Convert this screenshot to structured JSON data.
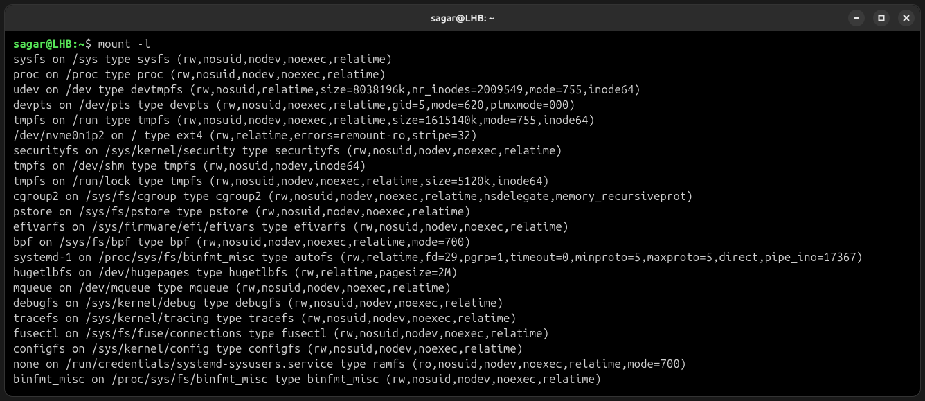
{
  "titlebar": {
    "title": "sagar@LHB: ~"
  },
  "prompt": {
    "user_host": "sagar@LHB",
    "colon": ":",
    "path": "~",
    "dollar": "$ ",
    "command": "mount -l"
  },
  "output_lines": [
    "sysfs on /sys type sysfs (rw,nosuid,nodev,noexec,relatime)",
    "proc on /proc type proc (rw,nosuid,nodev,noexec,relatime)",
    "udev on /dev type devtmpfs (rw,nosuid,relatime,size=8038196k,nr_inodes=2009549,mode=755,inode64)",
    "devpts on /dev/pts type devpts (rw,nosuid,noexec,relatime,gid=5,mode=620,ptmxmode=000)",
    "tmpfs on /run type tmpfs (rw,nosuid,nodev,noexec,relatime,size=1615140k,mode=755,inode64)",
    "/dev/nvme0n1p2 on / type ext4 (rw,relatime,errors=remount-ro,stripe=32)",
    "securityfs on /sys/kernel/security type securityfs (rw,nosuid,nodev,noexec,relatime)",
    "tmpfs on /dev/shm type tmpfs (rw,nosuid,nodev,inode64)",
    "tmpfs on /run/lock type tmpfs (rw,nosuid,nodev,noexec,relatime,size=5120k,inode64)",
    "cgroup2 on /sys/fs/cgroup type cgroup2 (rw,nosuid,nodev,noexec,relatime,nsdelegate,memory_recursiveprot)",
    "pstore on /sys/fs/pstore type pstore (rw,nosuid,nodev,noexec,relatime)",
    "efivarfs on /sys/firmware/efi/efivars type efivarfs (rw,nosuid,nodev,noexec,relatime)",
    "bpf on /sys/fs/bpf type bpf (rw,nosuid,nodev,noexec,relatime,mode=700)",
    "systemd-1 on /proc/sys/fs/binfmt_misc type autofs (rw,relatime,fd=29,pgrp=1,timeout=0,minproto=5,maxproto=5,direct,pipe_ino=17367)",
    "hugetlbfs on /dev/hugepages type hugetlbfs (rw,relatime,pagesize=2M)",
    "mqueue on /dev/mqueue type mqueue (rw,nosuid,nodev,noexec,relatime)",
    "debugfs on /sys/kernel/debug type debugfs (rw,nosuid,nodev,noexec,relatime)",
    "tracefs on /sys/kernel/tracing type tracefs (rw,nosuid,nodev,noexec,relatime)",
    "fusectl on /sys/fs/fuse/connections type fusectl (rw,nosuid,nodev,noexec,relatime)",
    "configfs on /sys/kernel/config type configfs (rw,nosuid,nodev,noexec,relatime)",
    "none on /run/credentials/systemd-sysusers.service type ramfs (ro,nosuid,nodev,noexec,relatime,mode=700)",
    "binfmt_misc on /proc/sys/fs/binfmt_misc type binfmt_misc (rw,nosuid,nodev,noexec,relatime)"
  ]
}
